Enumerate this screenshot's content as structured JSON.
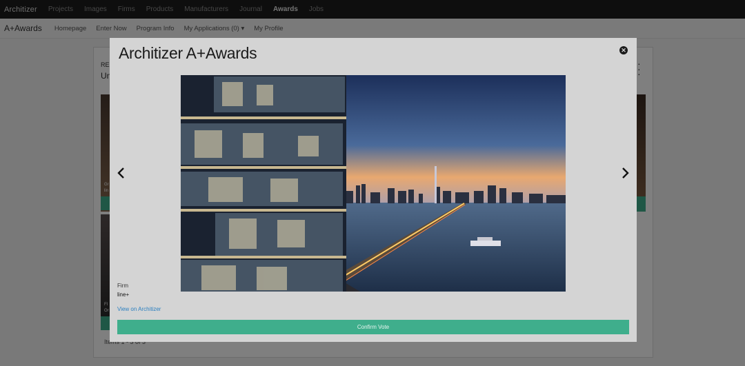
{
  "topnav": {
    "logo": "Architizer",
    "links": [
      "Projects",
      "Images",
      "Firms",
      "Products",
      "Manufacturers",
      "Journal",
      "Awards",
      "Jobs"
    ]
  },
  "subnav": {
    "brand": "A+Awards",
    "links": [
      "Homepage",
      "Enter Now",
      "Program Info",
      "My Applications (0) ▾",
      "My Profile"
    ]
  },
  "background": {
    "res": "RE",
    "un": "Un",
    "thumb1_text": [
      "Gr",
      "lin"
    ],
    "thumb2_text": [
      "Fl",
      "Or"
    ],
    "items": "Items 1 - 3 of 3"
  },
  "modal": {
    "logo_a": "Architizer",
    "logo_b": " A+Awards",
    "close_icon": "close-icon",
    "prev_icon": "chevron-left-icon",
    "next_icon": "chevron-right-icon",
    "firm_label": "Firm",
    "firm_value": "line+",
    "view_link": "View on Architizer",
    "confirm": "Confirm Vote"
  },
  "colors": {
    "accent": "#3fae8c",
    "link": "#2a7fc0",
    "topnav_bg": "#1c1c1c"
  }
}
